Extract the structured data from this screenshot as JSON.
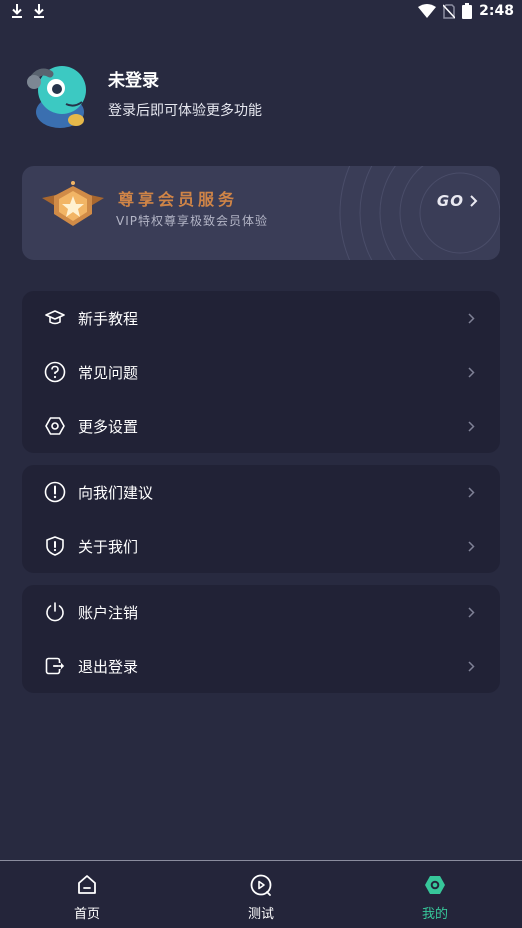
{
  "status_bar": {
    "time": "2:48",
    "left_icons": [
      "download-icon",
      "download-icon"
    ],
    "right_icons": [
      "wifi-icon",
      "no-sim-icon",
      "battery-icon"
    ]
  },
  "profile": {
    "name": "未登录",
    "subtitle": "登录后即可体验更多功能",
    "avatar_icon": "chameleon-mascot-icon"
  },
  "vip_banner": {
    "title": "尊享会员服务",
    "subtitle": "VIP特权尊享极致会员体验",
    "go_label": "GO",
    "title_color": "#cf8447"
  },
  "menu_groups": [
    {
      "items": [
        {
          "label": "新手教程",
          "icon": "graduation-cap-icon"
        },
        {
          "label": "常见问题",
          "icon": "question-circle-icon"
        },
        {
          "label": "更多设置",
          "icon": "settings-hexagon-icon"
        }
      ]
    },
    {
      "items": [
        {
          "label": "向我们建议",
          "icon": "exclamation-circle-icon"
        },
        {
          "label": "关于我们",
          "icon": "shield-icon"
        }
      ]
    },
    {
      "items": [
        {
          "label": "账户注销",
          "icon": "power-icon"
        },
        {
          "label": "退出登录",
          "icon": "logout-icon"
        }
      ]
    }
  ],
  "bottom_nav": {
    "tabs": [
      {
        "label": "首页",
        "icon": "home-icon",
        "active": false
      },
      {
        "label": "测试",
        "icon": "test-play-icon",
        "active": false
      },
      {
        "label": "我的",
        "icon": "profile-hexagon-icon",
        "active": true
      }
    ],
    "active_color": "#37c79a"
  }
}
